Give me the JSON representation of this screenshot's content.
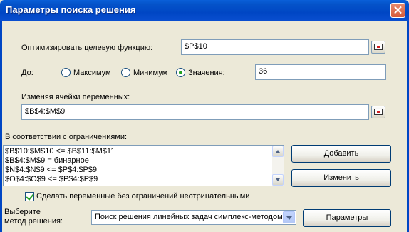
{
  "window": {
    "title": "Параметры поиска решения"
  },
  "objective": {
    "label": "Оптимизировать целевую функцию:",
    "value": "$P$10"
  },
  "direction": {
    "label": "До:",
    "options": [
      {
        "label": "Максимум",
        "selected": false
      },
      {
        "label": "Минимум",
        "selected": false
      },
      {
        "label": "Значения:",
        "selected": true
      }
    ],
    "value": "36"
  },
  "variables": {
    "label": "Изменяя ячейки переменных:",
    "value": "$B$4:$M$9"
  },
  "constraints": {
    "label": "В соответствии с ограничениями:",
    "items": [
      "$B$10:$M$10 <= $B$11:$M$11",
      "$B$4:$M$9 = бинарное",
      "$N$4:$N$9 <= $P$4:$P$9",
      "$O$4:$O$9 <= $P$4:$P$9"
    ],
    "add_label": "Добавить",
    "change_label": "Изменить"
  },
  "nonnegative": {
    "label": "Сделать переменные без ограничений неотрицательными",
    "checked": true
  },
  "method": {
    "label_line1": "Выберите",
    "label_line2": "метод решения:",
    "selected": "Поиск решения линейных задач симплекс-методом",
    "params_label": "Параметры"
  },
  "colors": {
    "titlebar": "#0046c4",
    "dialog_bg": "#ece9d8",
    "radio_dot": "#21a121"
  }
}
